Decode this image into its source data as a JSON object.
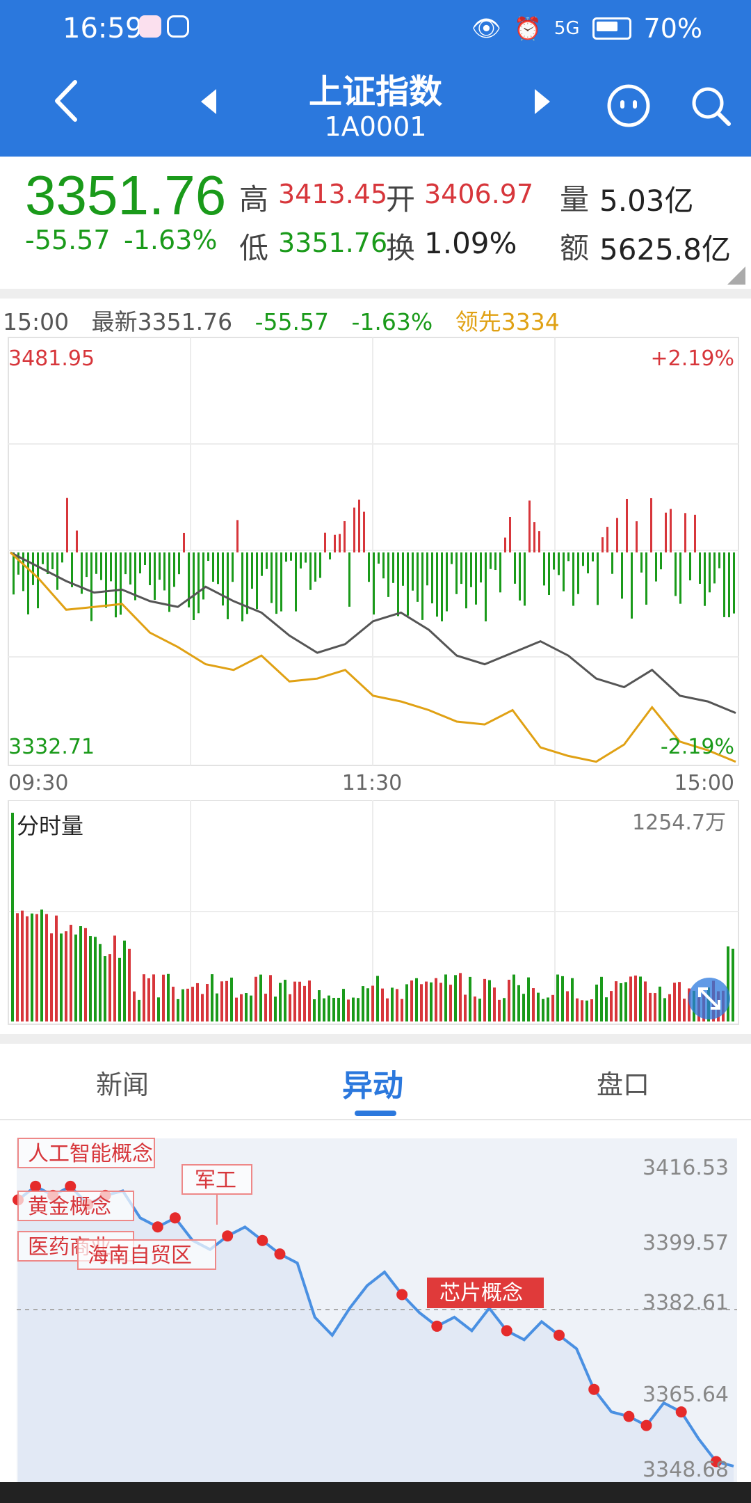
{
  "status_bar": {
    "time": "16:59",
    "battery": "70%",
    "signal": "5G"
  },
  "nav": {
    "title": "上证指数",
    "code": "1A0001"
  },
  "quote": {
    "price": "3351.76",
    "change": "-55.57",
    "change_pct": "-1.63%",
    "high_label": "高",
    "high": "3413.45",
    "open_label": "开",
    "open": "3406.97",
    "volume_label": "量",
    "volume": "5.03亿",
    "low_label": "低",
    "low": "3351.76",
    "turnover_label": "换",
    "turnover": "1.09%",
    "amount_label": "额",
    "amount": "5625.8亿"
  },
  "chart_header": {
    "time": "15:00",
    "latest": "最新3351.76",
    "change": "-55.57",
    "change_pct": "-1.63%",
    "lead": "领先3334"
  },
  "price_chart": {
    "y_max": "3481.95",
    "y_min": "3332.71",
    "pct_max": "+2.19%",
    "pct_min": "-2.19%",
    "x_labels": [
      "09:30",
      "11:30",
      "15:00"
    ]
  },
  "volume_chart": {
    "title": "分时量",
    "max": "1254.7万"
  },
  "tabs": {
    "news": "新闻",
    "moves": "异动",
    "book": "盘口"
  },
  "moves_chart": {
    "y_labels": [
      "3416.53",
      "3399.57",
      "3382.61",
      "3365.64",
      "3348.68"
    ],
    "annotations": [
      "人工智能概念",
      "黄金概念",
      "医药商业",
      "海南自贸区",
      "军工",
      "芯片概念"
    ]
  },
  "colors": {
    "accent": "#2b78dd",
    "up": "#d7363b",
    "down": "#1a9a1a",
    "lead_line": "#e0a114",
    "price_line": "#555555"
  },
  "chart_data": [
    {
      "type": "line",
      "title": "",
      "x_labels": [
        "09:30",
        "11:30",
        "15:00"
      ],
      "ylim": [
        3332.71,
        3481.95
      ],
      "series": [
        {
          "name": "最新",
          "values": [
            3407,
            3402,
            3397,
            3393,
            3394,
            3390,
            3388,
            3395,
            3390,
            3386,
            3378,
            3372,
            3375,
            3383,
            3386,
            3380,
            3371,
            3368,
            3372,
            3376,
            3371,
            3363,
            3360,
            3366,
            3357,
            3355,
            3351
          ]
        },
        {
          "name": "领先",
          "values": [
            3407,
            3398,
            3387,
            3388,
            3389,
            3379,
            3374,
            3368,
            3366,
            3371,
            3362,
            3363,
            3366,
            3357,
            3355,
            3352,
            3348,
            3347,
            3352,
            3339,
            3336,
            3334,
            3340,
            3353,
            3341,
            3338,
            3334
          ]
        }
      ]
    }
  ]
}
